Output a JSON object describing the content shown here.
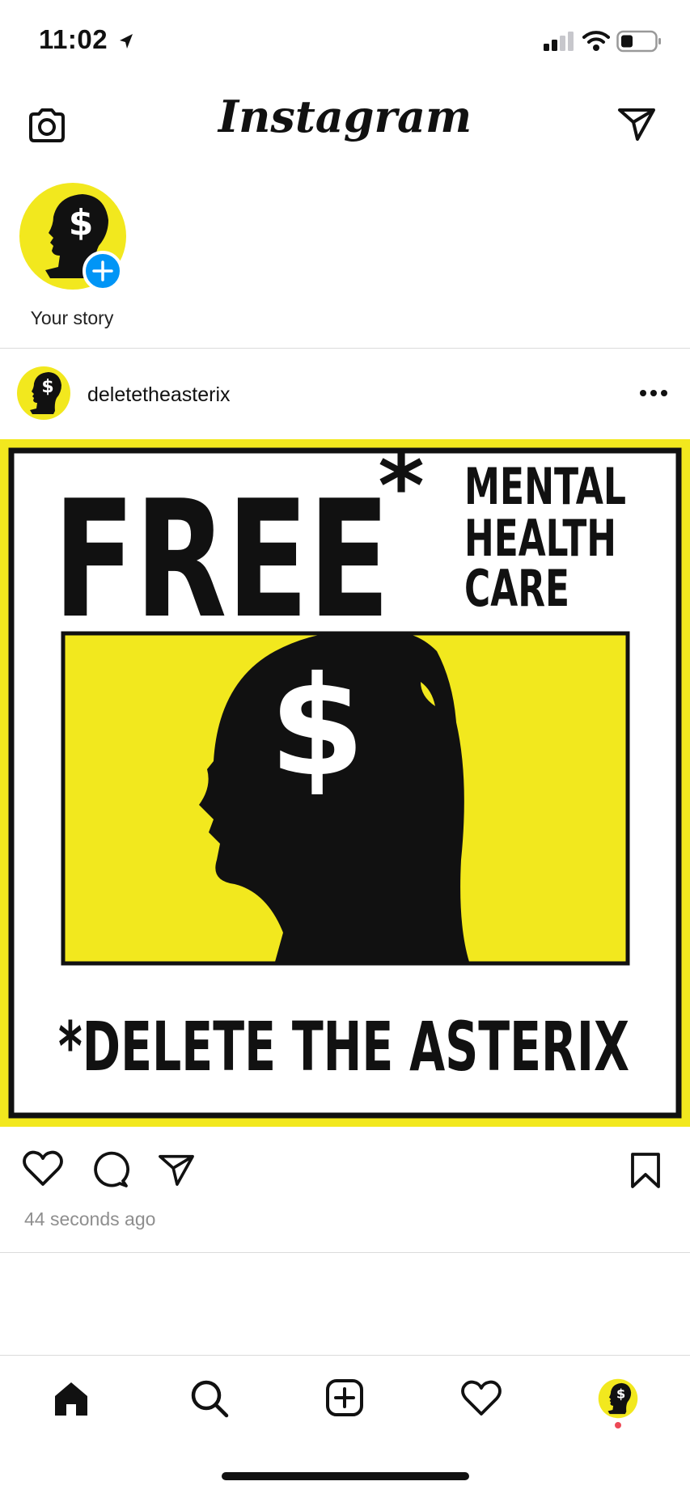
{
  "status_bar": {
    "time": "11:02"
  },
  "header": {
    "logo": "Instagram"
  },
  "stories": {
    "own_label": "Your story",
    "avatar_text": "$"
  },
  "post": {
    "username": "deletetheasterix",
    "timestamp": "44 seconds ago",
    "image": {
      "headline": "FREE",
      "asterisk": "*",
      "tagline_lines": [
        "MENTAL",
        "HEALTH",
        "CARE"
      ],
      "symbol": "$",
      "footer": "*DELETE THE ASTERIX",
      "colors": {
        "yellow": "#f2e81e",
        "black": "#111111",
        "white": "#ffffff"
      }
    }
  },
  "colors": {
    "accent_blue": "#0095f6",
    "notification_red": "#ed4956",
    "muted": "#8e8e8e"
  },
  "nav": {
    "items": [
      "home-icon",
      "search-icon",
      "new-post-icon",
      "activity-icon",
      "profile-avatar"
    ]
  }
}
